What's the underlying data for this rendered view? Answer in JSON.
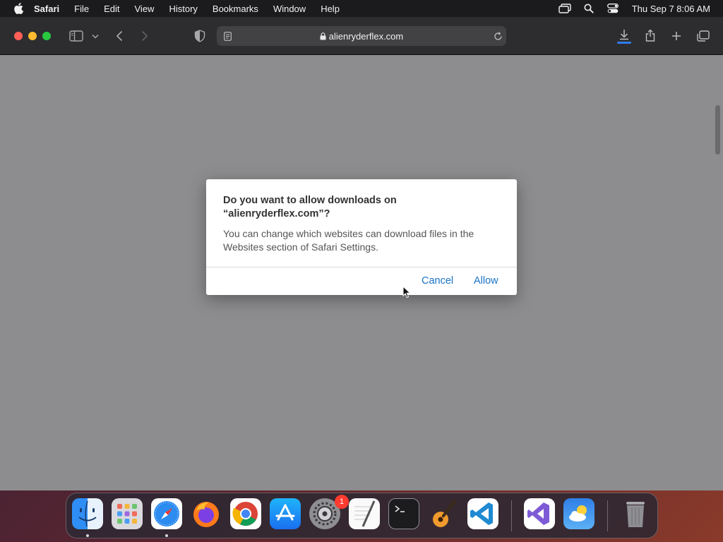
{
  "menubar": {
    "app_name": "Safari",
    "items": [
      "File",
      "Edit",
      "View",
      "History",
      "Bookmarks",
      "Window",
      "Help"
    ],
    "clock": "Thu Sep 7  8:06 AM",
    "status_icons": [
      "screen-mirroring-icon",
      "search-icon",
      "control-center-icon"
    ]
  },
  "browser": {
    "url": "alienryderflex.com",
    "accent_color": "#2f7cf6"
  },
  "dialog": {
    "title": "Do you want to allow downloads on “alienryderflex.com”?",
    "message": "You can change which websites can download files in the Websites section of Safari Settings.",
    "cancel_label": "Cancel",
    "allow_label": "Allow",
    "button_color": "#1a73c8"
  },
  "dock": {
    "apps": [
      "Finder",
      "Launchpad",
      "Safari",
      "Firefox",
      "Google Chrome",
      "App Store",
      "System Settings",
      "TextEdit",
      "Terminal",
      "GarageBand",
      "Visual Studio Code",
      "Visual Studio",
      "Weather",
      "Trash"
    ],
    "settings_badge": "1"
  }
}
